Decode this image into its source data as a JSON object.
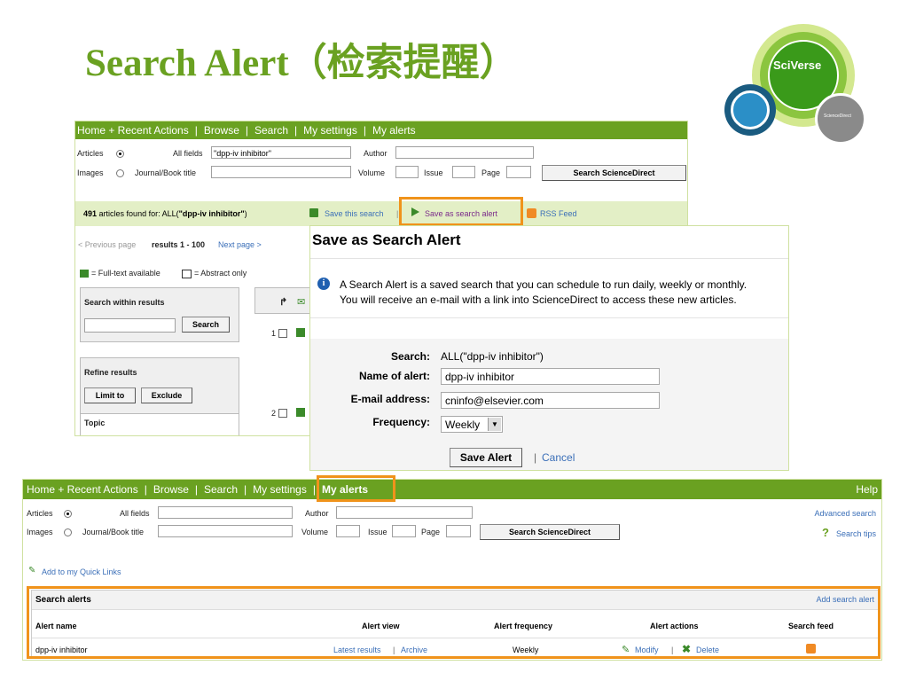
{
  "slide_title": "Search Alert（检索提醒）",
  "logo": {
    "main": "SciVerse",
    "sub": "ScienceDirect"
  },
  "top_shot": {
    "nav": [
      "Home + Recent Actions",
      "Browse",
      "Search",
      "My settings",
      "My alerts"
    ],
    "form": {
      "articles": "Articles",
      "images": "Images",
      "all_fields": "All fields",
      "all_fields_value": "\"dpp-iv inhibitor\"",
      "author": "Author",
      "journal": "Journal/Book title",
      "volume": "Volume",
      "issue": "Issue",
      "page": "Page",
      "search_button": "Search ScienceDirect"
    },
    "results_count": "491",
    "results_text": "articles found for: ALL(",
    "results_query": "\"dpp-iv inhibitor\"",
    "results_close": ")",
    "save_search": "Save this search",
    "save_alert": "Save as search alert",
    "rss": "RSS Feed",
    "prev_page": "< Previous page",
    "results_range": "results 1 - 100",
    "next_page": "Next page >",
    "fulltext_legend": "= Full-text available",
    "abstract_legend": "= Abstract only",
    "search_within": "Search within results",
    "search_button": "Search",
    "refine": "Refine results",
    "limit_to": "Limit to",
    "exclude": "Exclude",
    "topic": "Topic",
    "row1": "1",
    "row2": "2"
  },
  "dialog": {
    "title": "Save as Search Alert",
    "info_line1": "A Search Alert is a saved search that you can schedule to run daily, weekly or monthly.",
    "info_line2": "You will receive an e-mail with a link into ScienceDirect to access these new articles.",
    "search_label": "Search:",
    "search_value": "ALL(\"dpp-iv inhibitor\")",
    "name_label": "Name of alert:",
    "name_value": "dpp-iv inhibitor",
    "email_label": "E-mail address:",
    "email_value": "cninfo@elsevier.com",
    "frequency_label": "Frequency:",
    "frequency_value": "Weekly",
    "save_button": "Save Alert",
    "cancel": "Cancel"
  },
  "bottom_shot": {
    "nav": [
      "Home + Recent Actions",
      "Browse",
      "Search",
      "My settings",
      "My alerts"
    ],
    "help": "Help",
    "form": {
      "articles": "Articles",
      "images": "Images",
      "all_fields": "All fields",
      "author": "Author",
      "journal": "Journal/Book title",
      "volume": "Volume",
      "issue": "Issue",
      "page": "Page",
      "search_button": "Search ScienceDirect",
      "advanced": "Advanced search",
      "tips": "Search tips"
    },
    "quick_links": "Add to my Quick Links",
    "alerts_title": "Search alerts",
    "add_alert": "Add search alert",
    "columns": {
      "name": "Alert name",
      "view": "Alert view",
      "frequency": "Alert frequency",
      "actions": "Alert actions",
      "feed": "Search feed"
    },
    "row": {
      "name": "dpp-iv inhibitor",
      "latest": "Latest results",
      "archive": "Archive",
      "frequency": "Weekly",
      "modify": "Modify",
      "delete": "Delete"
    }
  },
  "colors": {
    "green": "#6aa121",
    "orange": "#f0931b",
    "link": "#3b6fb8",
    "light_green": "#e3efc6"
  }
}
